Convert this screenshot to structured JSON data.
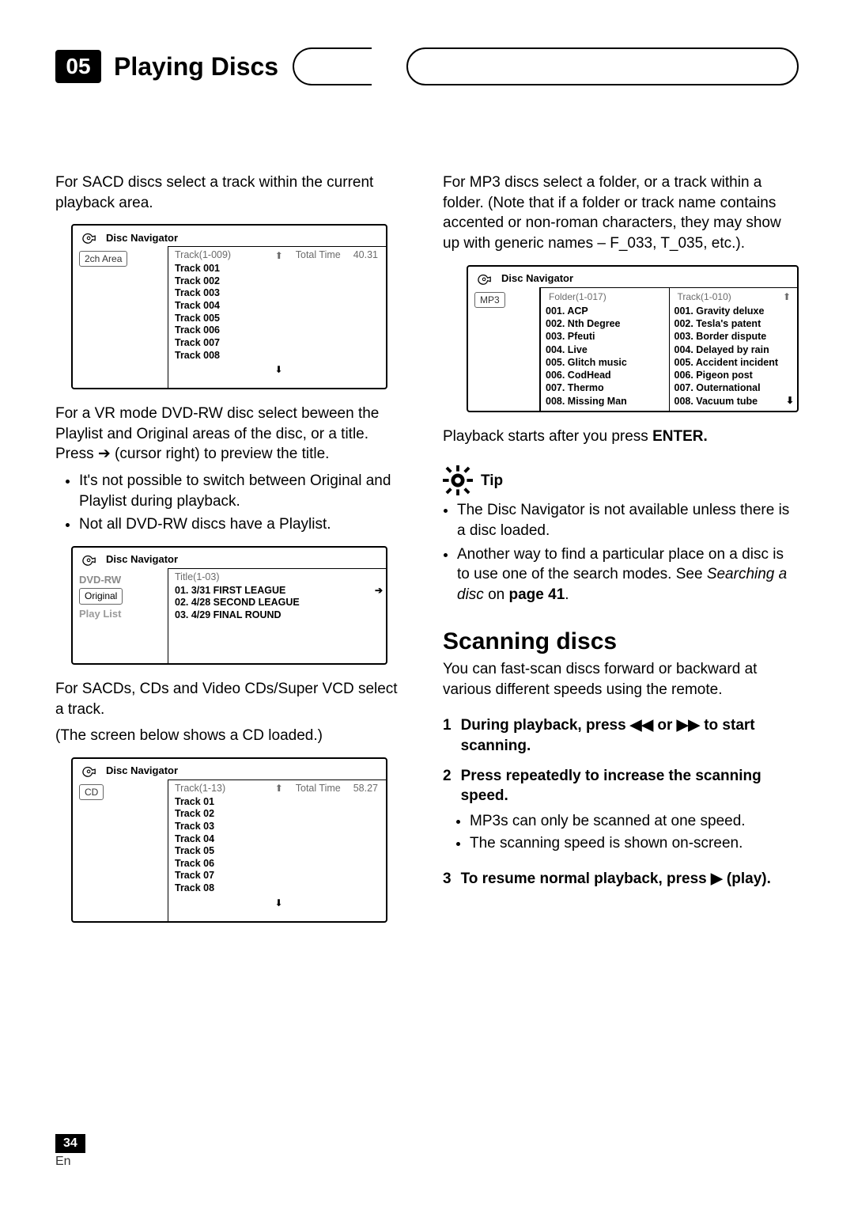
{
  "section": {
    "number": "05",
    "title": "Playing Discs"
  },
  "left": {
    "p1": "For SACD discs select a track within the current playback area.",
    "osd1": {
      "title": "Disc Navigator",
      "side_label": "2ch Area",
      "track_range": "Track(1-009)",
      "total_time_label": "Total Time",
      "total_time_value": "40.31",
      "tracks": [
        "Track 001",
        "Track 002",
        "Track 003",
        "Track 004",
        "Track 005",
        "Track 006",
        "Track 007",
        "Track 008"
      ]
    },
    "p2": "For a VR mode DVD-RW disc select beween the Playlist and Original areas of the disc, or a title. Press ➔ (cursor right) to preview the title.",
    "bul1": [
      "It's not possible to switch between Original and Playlist during playback.",
      "Not all DVD-RW discs have a Playlist."
    ],
    "osd2": {
      "title": "Disc Navigator",
      "side_label_1": "DVD-RW",
      "side_label_2": "Original",
      "side_label_3": "Play List",
      "title_range": "Title(1-03)",
      "titles": [
        "01. 3/31 FIRST LEAGUE",
        "02. 4/28 SECOND LEAGUE",
        "03. 4/29 FINAL ROUND"
      ]
    },
    "p3": "For SACDs, CDs and Video CDs/Super VCD select a track.",
    "p4": "(The screen below shows a CD loaded.)",
    "osd3": {
      "title": "Disc Navigator",
      "side_label": "CD",
      "track_range": "Track(1-13)",
      "total_time_label": "Total Time",
      "total_time_value": "58.27",
      "tracks": [
        "Track 01",
        "Track 02",
        "Track 03",
        "Track 04",
        "Track 05",
        "Track 06",
        "Track 07",
        "Track 08"
      ]
    }
  },
  "right": {
    "p1": "For MP3 discs select a folder, or a  track within a folder. (Note that if a folder or track name contains accented or non-roman characters, they may show up with generic names – F_033, T_035, etc.).",
    "osd4": {
      "title": "Disc Navigator",
      "side_label": "MP3",
      "folder_label": "Folder(1-017)",
      "track_label": "Track(1-010)",
      "folders": [
        "001. ACP",
        "002. Nth Degree",
        "003. Pfeuti",
        "004. Live",
        "005. Glitch music",
        "006. CodHead",
        "007. Thermo",
        "008. Missing Man"
      ],
      "tracks": [
        "001. Gravity deluxe",
        "002. Tesla's patent",
        "003. Border dispute",
        "004. Delayed by rain",
        "005. Accident incident",
        "006. Pigeon post",
        "007. Outernational",
        "008. Vacuum tube"
      ]
    },
    "p2a": "Playback starts after you press ",
    "p2b": "ENTER.",
    "tip_label": "Tip",
    "tips": [
      "The Disc Navigator is not available unless there is a disc loaded."
    ],
    "tip2_a": "Another way to find a particular place on a disc is to use one of the search modes. See ",
    "tip2_b": "Searching a disc",
    "tip2_c": " on ",
    "tip2_d": "page 41",
    "tip2_e": ".",
    "h2": "Scanning discs",
    "p3": "You can fast-scan discs forward or backward at various different speeds using the remote.",
    "step1": "During playback, press ◀◀ or ▶▶ to start scanning.",
    "step2": "Press repeatedly to increase the scanning speed.",
    "step2_sub": [
      "MP3s can only be scanned at one speed.",
      "The scanning speed is shown on-screen."
    ],
    "step3": "To resume normal playback, press ▶ (play)."
  },
  "footer": {
    "page": "34",
    "lang": "En"
  }
}
